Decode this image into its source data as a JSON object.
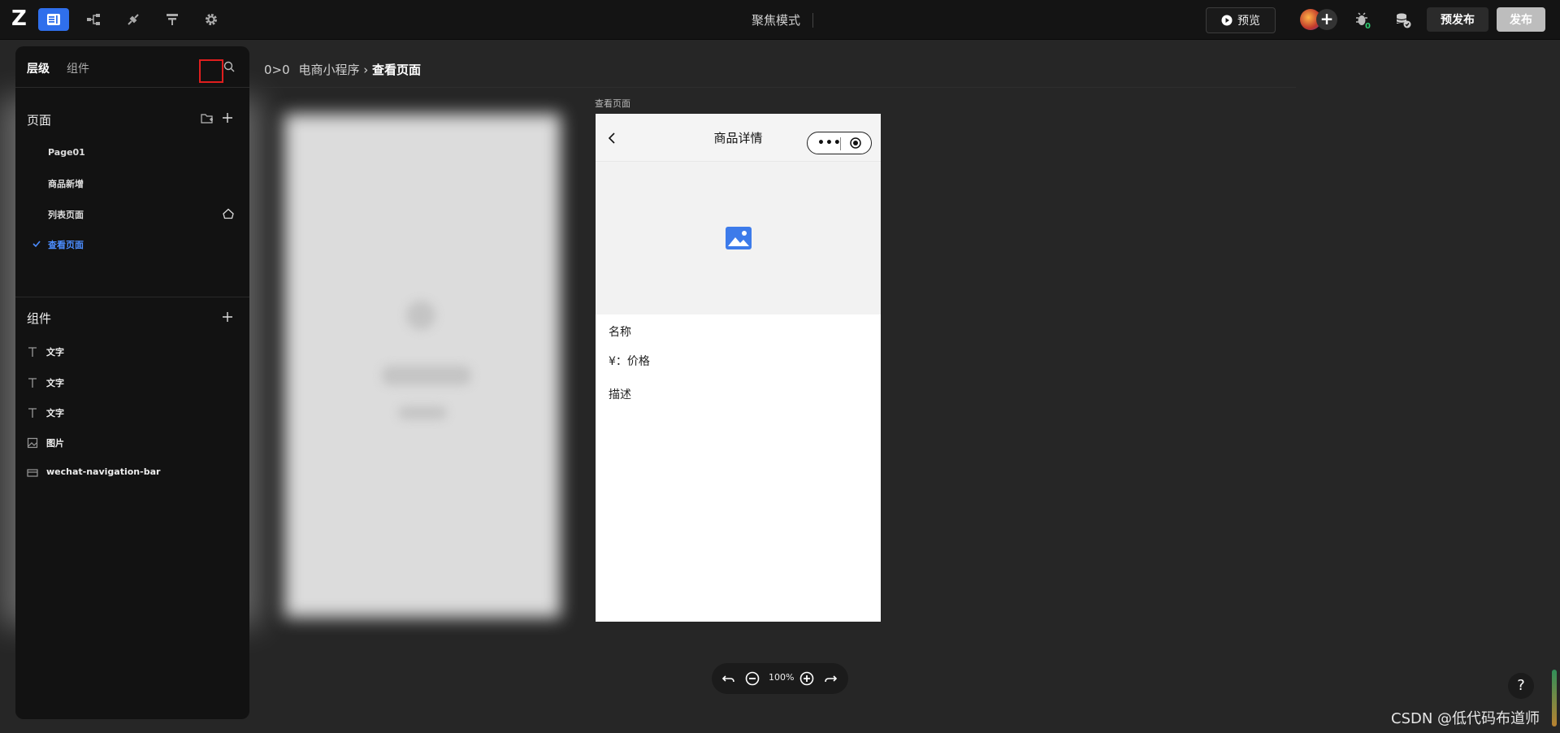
{
  "topbar": {
    "logo": "Z",
    "focus_mode": "聚焦模式",
    "preview": "预览",
    "pre_publish": "预发布",
    "publish": "发布",
    "avatar_add": "+"
  },
  "sidebar": {
    "tabs": [
      "层级",
      "组件"
    ],
    "pages_title": "页面",
    "pages": [
      "Page01",
      "商品新增",
      "列表页面",
      "查看页面"
    ],
    "components_title": "组件",
    "components": [
      "文字",
      "文字",
      "文字",
      "图片",
      "wechat-navigation-bar"
    ]
  },
  "breadcrumb": {
    "root": "0>0",
    "app": "电商小程序",
    "sep": "›",
    "current": "查看页面"
  },
  "canvas": {
    "page_label": "查看页面",
    "nav_title": "商品详情",
    "capsule_dots": "•••",
    "name": "名称",
    "price": "¥：价格",
    "desc": "描述"
  },
  "zoom": {
    "level": "100%"
  },
  "help": "?",
  "watermark": "CSDN @低代码布道师"
}
